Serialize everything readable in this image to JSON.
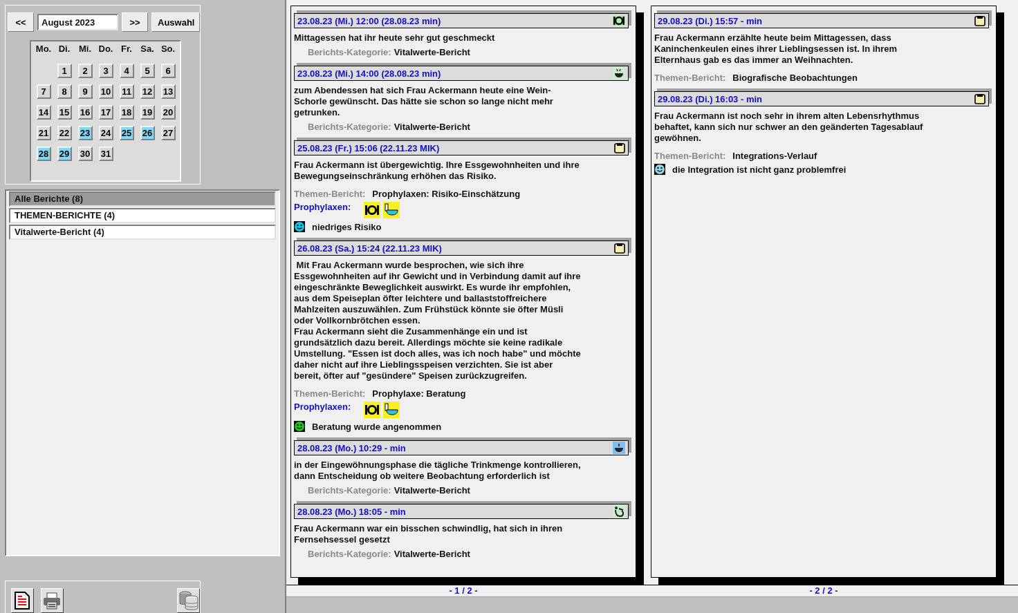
{
  "calendar": {
    "prev": "<<",
    "month": "August 2023",
    "next": ">>",
    "select": "Auswahl",
    "weekdays": [
      "Mo.",
      "Di.",
      "Mi.",
      "Do.",
      "Fr.",
      "Sa.",
      "So."
    ],
    "weeks": [
      {
        "days": [
          {
            "label": "1",
            "has_reports": false
          },
          {
            "label": "2",
            "has_reports": false
          },
          {
            "label": "3",
            "has_reports": false
          },
          {
            "label": "4",
            "has_reports": false
          },
          {
            "label": "5",
            "has_reports": false
          },
          {
            "label": "6",
            "has_reports": false
          }
        ]
      },
      {
        "days": [
          {
            "label": "7",
            "has_reports": false
          },
          {
            "label": "8",
            "has_reports": false
          },
          {
            "label": "9",
            "has_reports": false
          },
          {
            "label": "10",
            "has_reports": false
          },
          {
            "label": "11",
            "has_reports": false
          },
          {
            "label": "12",
            "has_reports": false
          },
          {
            "label": "13",
            "has_reports": false
          }
        ]
      },
      {
        "days": [
          {
            "label": "14",
            "has_reports": false
          },
          {
            "label": "15",
            "has_reports": false
          },
          {
            "label": "16",
            "has_reports": false
          },
          {
            "label": "17",
            "has_reports": false
          },
          {
            "label": "18",
            "has_reports": false
          },
          {
            "label": "19",
            "has_reports": false
          },
          {
            "label": "20",
            "has_reports": false
          }
        ]
      },
      {
        "days": [
          {
            "label": "21",
            "has_reports": false
          },
          {
            "label": "22",
            "has_reports": false
          },
          {
            "label": "23",
            "has_reports": true
          },
          {
            "label": "24",
            "has_reports": false
          },
          {
            "label": "25",
            "has_reports": true
          },
          {
            "label": "26",
            "has_reports": true
          },
          {
            "label": "27",
            "has_reports": false
          }
        ]
      },
      {
        "days": [
          {
            "label": "28",
            "has_reports": true
          },
          {
            "label": "29",
            "has_reports": true
          },
          {
            "label": "30",
            "has_reports": false
          },
          {
            "label": "31",
            "has_reports": false
          }
        ]
      }
    ]
  },
  "filters": [
    {
      "label": "Alle Berichte (8)",
      "selected": true
    },
    {
      "label": "THEMEN-BERICHTE (4)",
      "selected": false
    },
    {
      "label": "Vitalwerte-Bericht (4)",
      "selected": false
    }
  ],
  "pages": [
    {
      "footer": "- 1 / 2 -",
      "entries": [
        {
          "header": "23.08.23 (Mi.) 12:00 (28.08.23 min)",
          "kind": "meal",
          "text": "Mittagessen hat ihr heute sehr gut geschmeckt",
          "meta": {
            "kind": "category",
            "label": "Berichts-Kategorie:",
            "value": "Vitalwerte-Bericht"
          }
        },
        {
          "header": "23.08.23 (Mi.) 14:00 (28.08.23 min)",
          "kind": "drink",
          "text": "zum Abendessen hat sich Frau Ackermann heute eine Wein-\nSchorle gewünscht. Das hätte sie schon so lange nicht mehr\ngetrunken.",
          "meta": {
            "kind": "category",
            "label": "Berichts-Kategorie:",
            "value": "Vitalwerte-Bericht"
          }
        },
        {
          "header": "25.08.23 (Fr.) 15:06 (22.11.23 MIK)",
          "kind": "clipboard",
          "text": "Frau Ackermann ist übergewichtig. Ihre Essgewohnheiten und ihre\nBewegungseinschränkung erhöhen das Risiko.",
          "meta": {
            "kind": "topic",
            "label": "Themen-Bericht:",
            "value": "Prophylaxen: Risiko-Einschätzung"
          },
          "prophylaxes": {
            "label": "Prophylaxen:",
            "icons": [
              {
                "kind": "meal"
              },
              {
                "kind": "toilet"
              }
            ]
          },
          "result": {
            "color": "#00c8e8",
            "text": "niedriges Risiko"
          }
        },
        {
          "header": "26.08.23 (Sa.) 15:24 (22.11.23 MIK)",
          "kind": "clipboard",
          "text": " Mit Frau Ackermann wurde besprochen, wie sich ihre\nEssgewohnheiten auf ihr Gewicht und in Verbindung damit auf ihre\neingeschränkte Beweglichkeit auswirkt. Es wurde ihr empfohlen,\naus dem Speiseplan öfter leichtere und ballaststoffreichere\nMahlzeiten auszuwählen. Zum Frühstück könnte sie öfter Müsli\noder Vollkornbrötchen essen.\nFrau Ackermann sieht die Zusammenhänge ein und ist\ngrundsätzlich dazu bereit. Allerdings möchte sie keine radikale\nUmstellung. \"Essen ist doch alles, was ich noch habe\" und möchte\ndaher nicht auf ihre Lieblingsspeisen verzichten. Sie ist aber\nbereit, öfter auf \"gesündere\" Speisen zurückzugreifen.",
          "meta": {
            "kind": "topic",
            "label": "Themen-Bericht:",
            "value": "Prophylaxe: Beratung"
          },
          "prophylaxes": {
            "label": "Prophylaxen:",
            "icons": [
              {
                "kind": "meal"
              },
              {
                "kind": "toilet"
              }
            ]
          },
          "result": {
            "color": "#20c020",
            "text": "Beratung wurde angenommen"
          }
        },
        {
          "header": "28.08.23 (Mo.) 10:29 - min",
          "kind": "cup",
          "text": "in der Eingewöhnungsphase die tägliche Trinkmenge kontrollieren,\ndann Entscheidung ob weitere Beobachtung erforderlich ist",
          "meta": {
            "kind": "category",
            "label": "Berichts-Kategorie:",
            "value": "Vitalwerte-Bericht"
          }
        },
        {
          "header": "28.08.23 (Mo.) 18:05 - min",
          "kind": "person",
          "text": "Frau Ackermann war ein bisschen schwindlig, hat sich in ihren\nFernsehsessel gesetzt",
          "meta": {
            "kind": "category",
            "label": "Berichts-Kategorie:",
            "value": "Vitalwerte-Bericht"
          }
        }
      ]
    },
    {
      "footer": "- 2 / 2 -",
      "entries": [
        {
          "header": "29.08.23 (Di.) 15:57 - min",
          "kind": "clipboard",
          "text": "Frau Ackermann erzählte heute beim Mittagessen, dass\nKaninchenkeulen eines ihrer Lieblingsessen ist. In ihrem\nElternhaus gab es das immer an Weihnachten.",
          "meta": {
            "kind": "topic",
            "label": "Themen-Bericht:",
            "value": "Biografische Beobachtungen"
          }
        },
        {
          "header": "29.08.23 (Di.) 16:03 - min",
          "kind": "clipboard",
          "text": "Frau Ackermann ist noch sehr in ihrem alten Lebensrhythmus\nbehaftet, kann sich nur schwer an den geänderten Tagesablauf\ngewöhnen.",
          "meta": {
            "kind": "topic",
            "label": "Themen-Bericht:",
            "value": "Integrations-Verlauf"
          },
          "result": {
            "color": "#90d8e8",
            "text": "die Integration ist nicht ganz problemfrei"
          }
        }
      ]
    }
  ]
}
